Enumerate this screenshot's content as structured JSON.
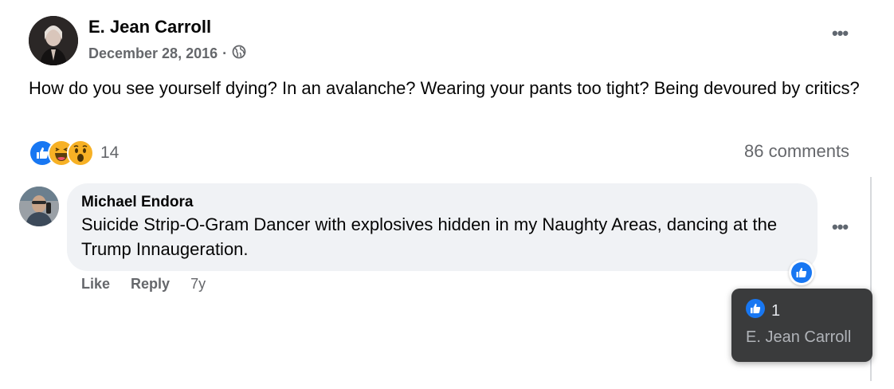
{
  "post": {
    "author": "E. Jean Carroll",
    "date": "December 28, 2016",
    "separator": "·",
    "audience_icon": "globe-icon",
    "more_icon": "more-options-icon",
    "text": "How do you see yourself dying? In an avalanche? Wearing your pants too tight? Being devoured by critics?",
    "reactions": {
      "icons": [
        "like-reaction-icon",
        "haha-reaction-icon",
        "wow-reaction-icon"
      ],
      "count": "14"
    },
    "comments_count": "86 comments"
  },
  "comment": {
    "author": "Michael Endora",
    "text": "Suicide Strip-O-Gram Dancer with explosives hidden in my Naughty Areas, dancing at the Trump Innaugeration.",
    "actions": {
      "like": "Like",
      "reply": "Reply",
      "time": "7y"
    },
    "reaction_icon": "like-reaction-icon",
    "tooltip": {
      "count": "1",
      "names": "E. Jean Carroll"
    }
  },
  "colors": {
    "like_blue": "#1877f2",
    "secondary_text": "#65676b",
    "bubble_bg": "#f0f2f5",
    "tooltip_bg": "#3a3b3c"
  }
}
